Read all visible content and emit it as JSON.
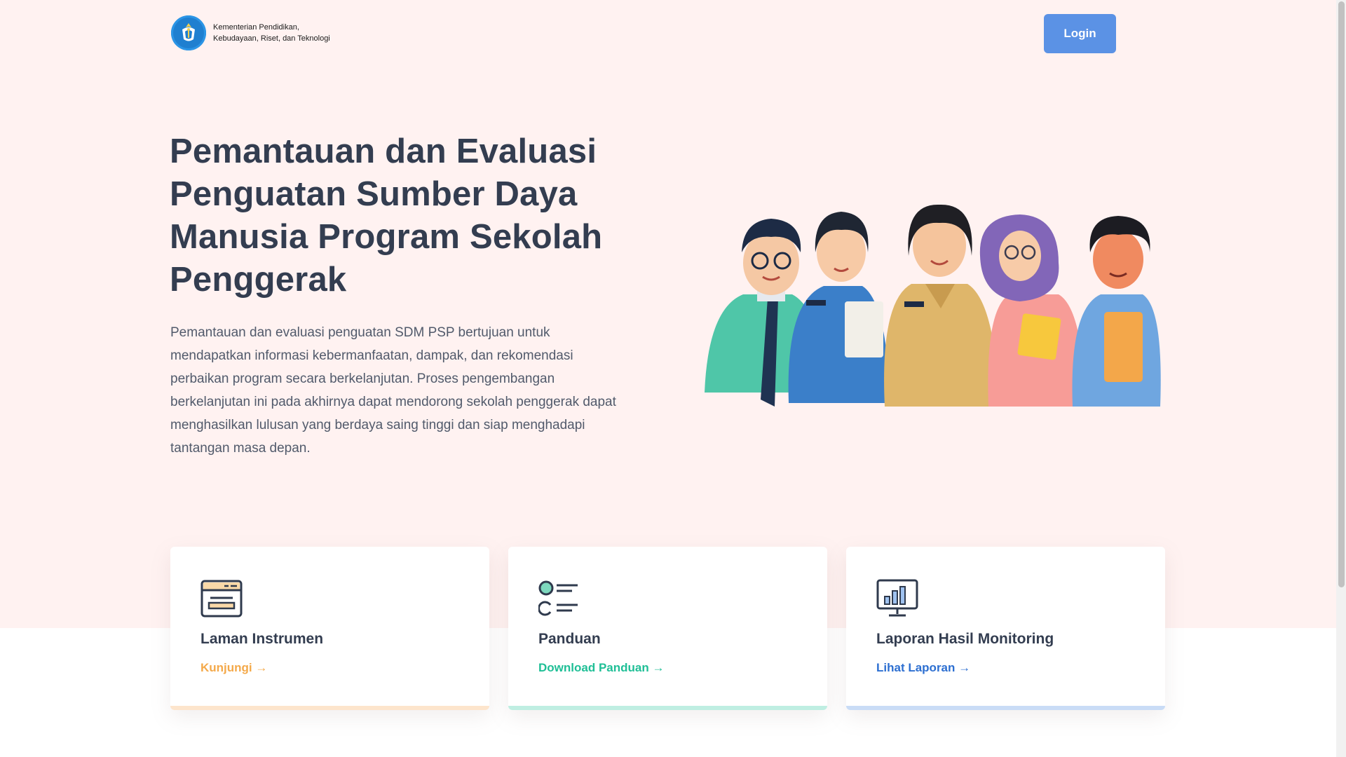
{
  "header": {
    "org_name_line1": "Kementerian Pendidikan,",
    "org_name_line2": "Kebudayaan, Riset, dan Teknologi",
    "login_label": "Login"
  },
  "hero": {
    "title": "Pemantauan dan Evaluasi Penguatan Sumber Daya Manusia Program Sekolah Penggerak",
    "description": "Pemantauan dan evaluasi penguatan SDM PSP bertujuan untuk mendapatkan informasi kebermanfaatan, dampak, dan rekomendasi perbaikan program secara berkelanjutan. Proses pengembangan berkelanjutan ini pada akhirnya dapat mendorong sekolah penggerak dapat menghasilkan lulusan yang berdaya saing tinggi dan siap menghadapi tantangan masa depan."
  },
  "cards": [
    {
      "icon": "browser-window-icon",
      "title": "Laman Instrumen",
      "link_label": "Kunjungi →",
      "accent": "#f4a94a"
    },
    {
      "icon": "checklist-icon",
      "title": "Panduan",
      "link_label": "Download Panduan →",
      "accent": "#1fbf96"
    },
    {
      "icon": "monitor-chart-icon",
      "title": "Laporan Hasil Monitoring",
      "link_label": "Lihat Laporan →",
      "accent": "#2d6fd1"
    }
  ],
  "colors": {
    "hero_background": "#fff2f1",
    "primary_button": "#5b92e5",
    "heading_text": "#333d50"
  }
}
